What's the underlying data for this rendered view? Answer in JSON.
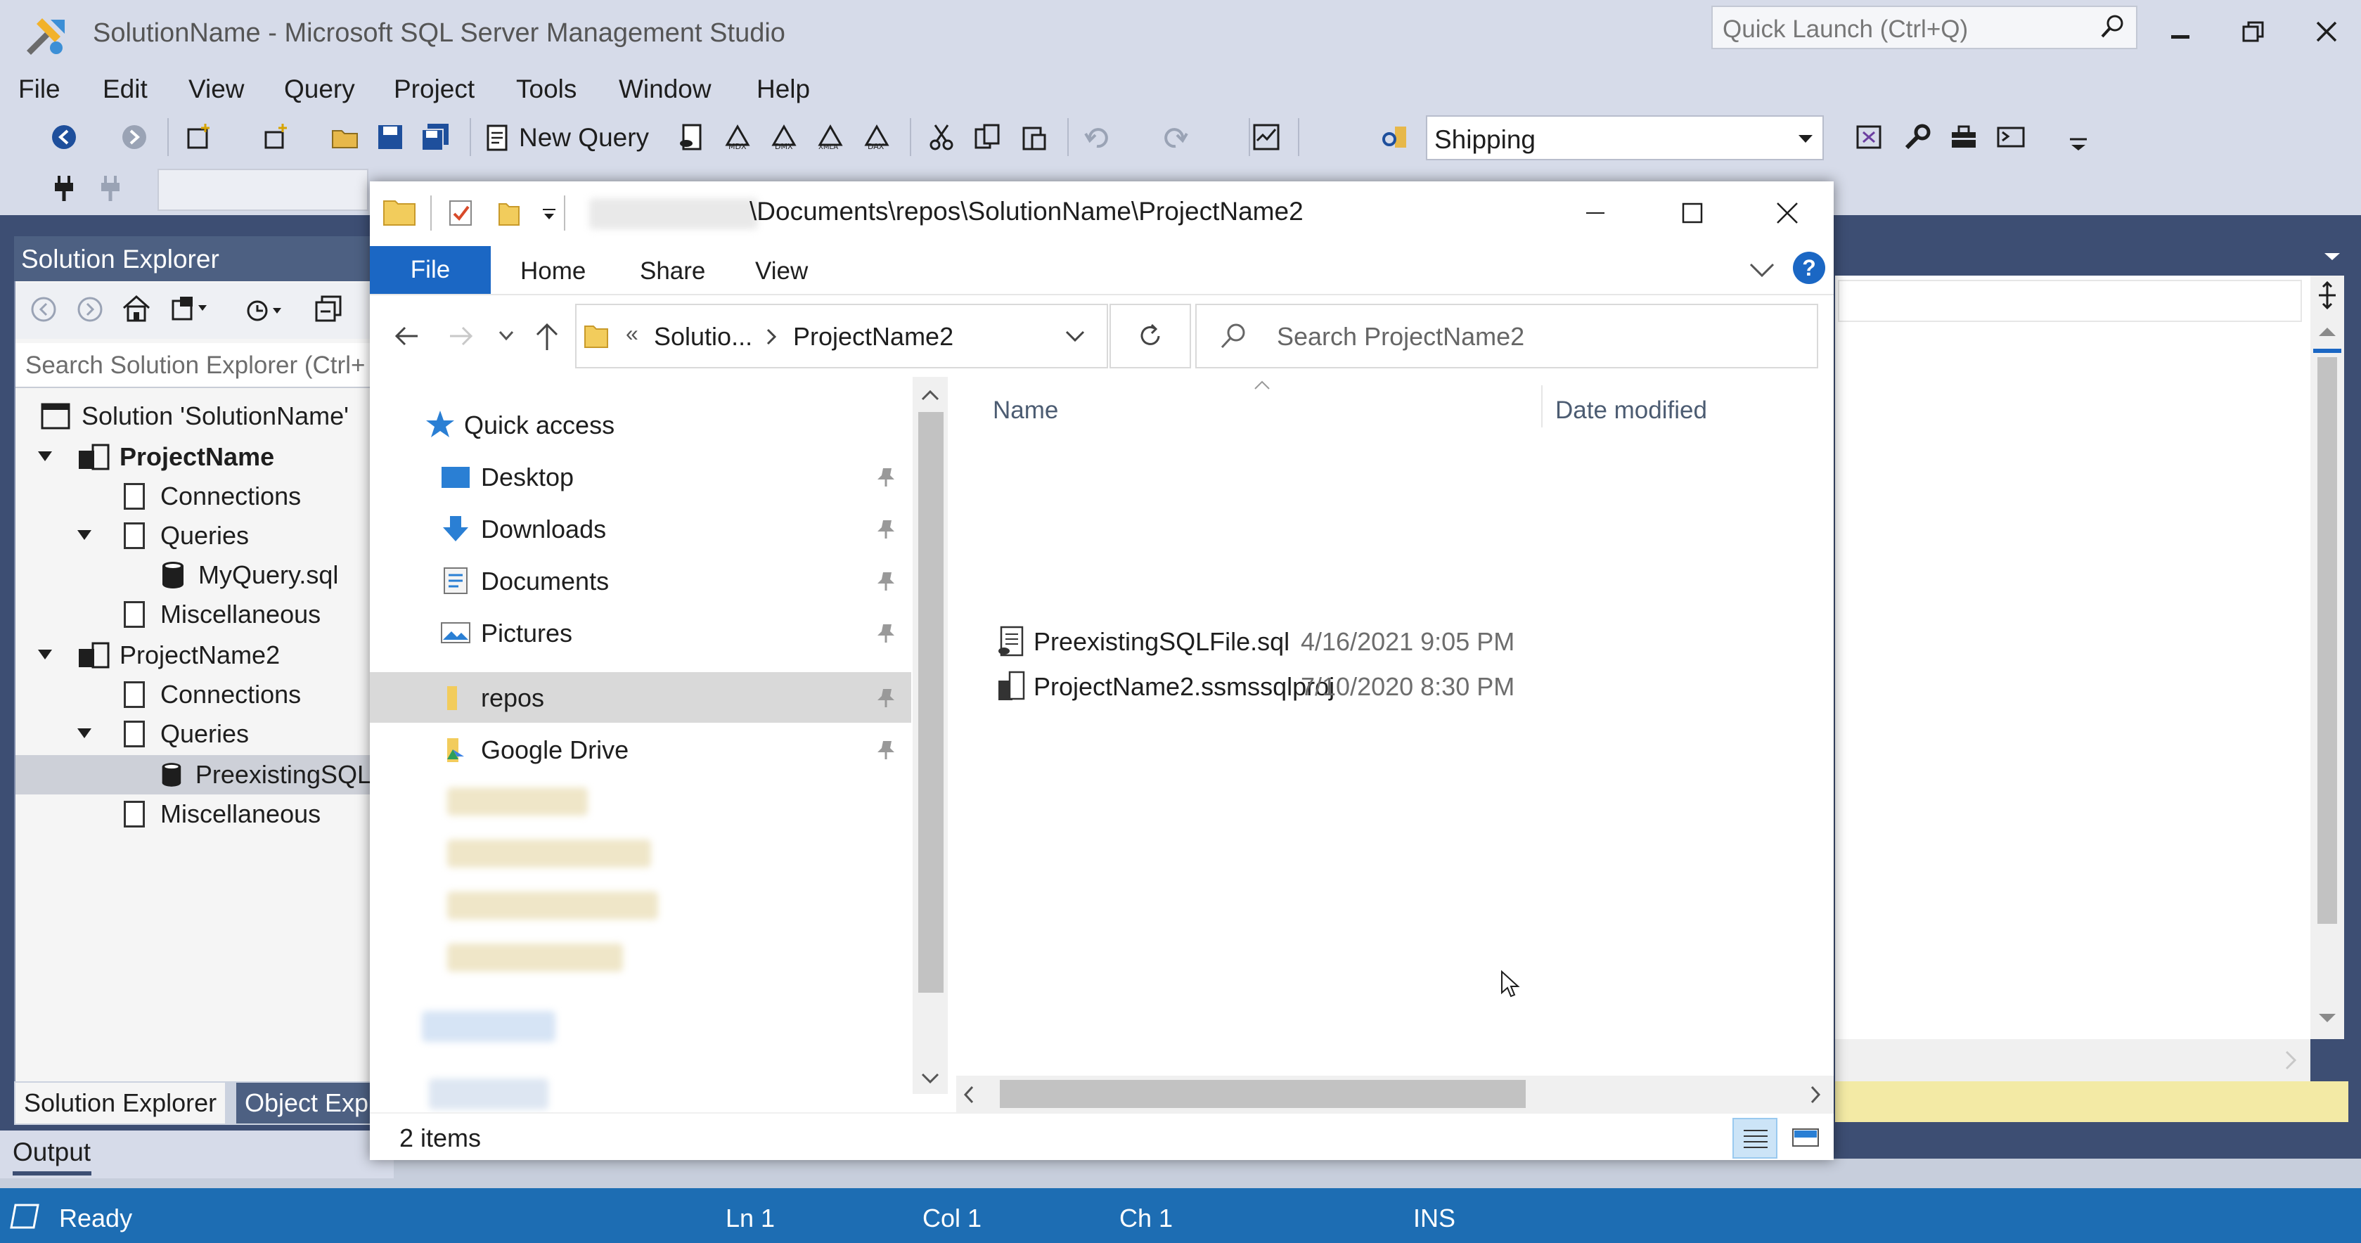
{
  "ssms": {
    "title": "SolutionName - Microsoft SQL Server Management Studio",
    "quick_launch_placeholder": "Quick Launch (Ctrl+Q)",
    "menu": [
      "File",
      "Edit",
      "View",
      "Query",
      "Project",
      "Tools",
      "Window",
      "Help"
    ],
    "toolbar": {
      "new_query": "New Query",
      "database_selected": "Shipping"
    },
    "solution_explorer": {
      "title": "Solution Explorer",
      "search_placeholder": "Search Solution Explorer (Ctrl+",
      "tree": {
        "solution": "Solution 'SolutionName'",
        "project1": "ProjectName",
        "p1_connections": "Connections",
        "p1_queries": "Queries",
        "p1_query_file": "MyQuery.sql",
        "p1_misc": "Miscellaneous",
        "project2": "ProjectName2",
        "p2_connections": "Connections",
        "p2_queries": "Queries",
        "p2_query_file": "PreexistingSQL",
        "p2_misc": "Miscellaneous"
      },
      "tabs": [
        "Solution Explorer",
        "Object Exp"
      ]
    },
    "output_label": "Output",
    "status": {
      "ready": "Ready",
      "ln": "Ln 1",
      "col": "Col 1",
      "ch": "Ch 1",
      "mode": "INS"
    }
  },
  "explorer": {
    "path_tail": "\\Documents\\repos\\SolutionName\\ProjectName2",
    "ribbon_tabs": {
      "file": "File",
      "home": "Home",
      "share": "Share",
      "view": "View"
    },
    "help": "?",
    "address": {
      "overflow": "«",
      "crumb1": "Solutio...",
      "crumb2": "ProjectName2"
    },
    "search_placeholder": "Search ProjectName2",
    "nav": {
      "quick_access": "Quick access",
      "items": [
        "Desktop",
        "Downloads",
        "Documents",
        "Pictures",
        "repos",
        "Google Drive"
      ]
    },
    "columns": {
      "name": "Name",
      "date_modified": "Date modified"
    },
    "files": [
      {
        "name": "PreexistingSQLFile.sql",
        "date": "4/16/2021 9:05 PM"
      },
      {
        "name": "ProjectName2.ssmssqlproj",
        "date": "7/10/2020 8:30 PM"
      }
    ],
    "item_count": "2 items"
  },
  "colors": {
    "accent": "#1b67c4",
    "status_bar": "#1d6db3",
    "ssms_chrome": "#d6dbe9",
    "editor_dark": "#3d4e73"
  }
}
